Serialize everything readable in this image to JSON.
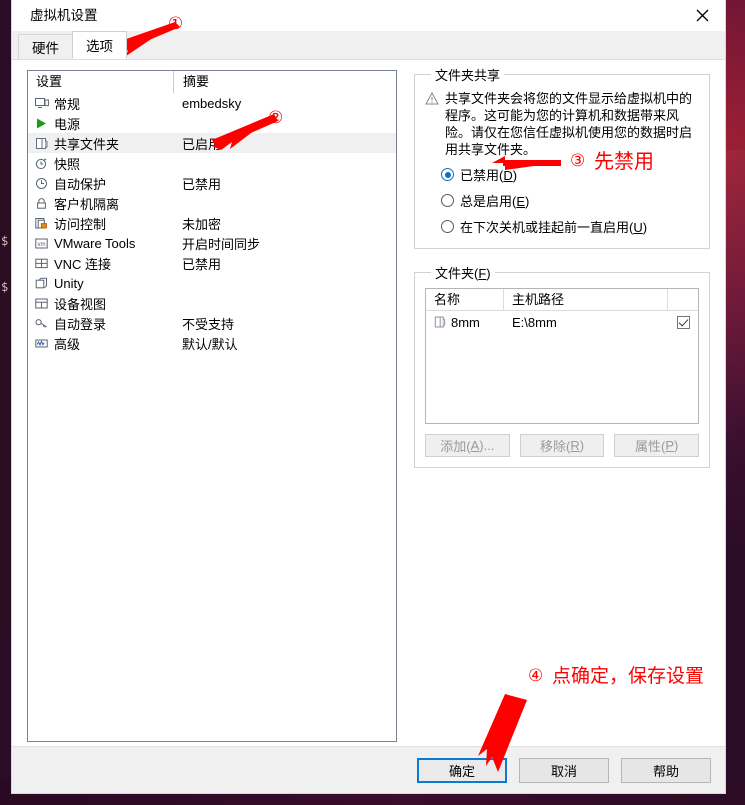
{
  "window": {
    "title": "虚拟机设置",
    "close_icon": "close-icon"
  },
  "tabs": [
    {
      "label": "硬件",
      "active": false
    },
    {
      "label": "选项",
      "active": true
    }
  ],
  "settings_list": {
    "headers": {
      "name": "设置",
      "summary": "摘要"
    },
    "rows": [
      {
        "icon": "monitor-icon",
        "label": "常规",
        "summary": "embedsky",
        "selected": false
      },
      {
        "icon": "power-play-icon",
        "label": "电源",
        "summary": "",
        "selected": false
      },
      {
        "icon": "shared-folder-icon",
        "label": "共享文件夹",
        "summary": "已启用",
        "selected": true
      },
      {
        "icon": "snapshot-clock-icon",
        "label": "快照",
        "summary": "",
        "selected": false
      },
      {
        "icon": "autoprotect-icon",
        "label": "自动保护",
        "summary": "已禁用",
        "selected": false
      },
      {
        "icon": "lock-icon",
        "label": "客户机隔离",
        "summary": "",
        "selected": false
      },
      {
        "icon": "access-control-icon",
        "label": "访问控制",
        "summary": "未加密",
        "selected": false
      },
      {
        "icon": "vmware-tools-icon",
        "label": "VMware Tools",
        "summary": "开启时间同步",
        "selected": false
      },
      {
        "icon": "vnc-icon",
        "label": "VNC 连接",
        "summary": "已禁用",
        "selected": false
      },
      {
        "icon": "unity-icon",
        "label": "Unity",
        "summary": "",
        "selected": false
      },
      {
        "icon": "device-view-icon",
        "label": "设备视图",
        "summary": "",
        "selected": false
      },
      {
        "icon": "autologin-key-icon",
        "label": "自动登录",
        "summary": "不受支持",
        "selected": false
      },
      {
        "icon": "advanced-icon",
        "label": "高级",
        "summary": "默认/默认",
        "selected": false
      }
    ]
  },
  "folder_sharing": {
    "legend": "文件夹共享",
    "warning_icon": "warning-triangle-icon",
    "warning_text": "共享文件夹会将您的文件显示给虚拟机中的程序。这可能为您的计算机和数据带来风险。请仅在您信任虚拟机使用您的数据时启用共享文件夹。",
    "options": [
      {
        "label": "已禁用(",
        "accel": "D",
        "tail": ")",
        "checked": true
      },
      {
        "label": "总是启用(",
        "accel": "E",
        "tail": ")",
        "checked": false
      },
      {
        "label": "在下次关机或挂起前一直启用(",
        "accel": "U",
        "tail": ")",
        "checked": false
      }
    ]
  },
  "folders": {
    "legend_pre": "文件夹(",
    "legend_accel": "F",
    "legend_post": ")",
    "columns": [
      "名称",
      "主机路径",
      ""
    ],
    "rows": [
      {
        "icon": "folder-icon",
        "name": "8mm",
        "path": "E:\\8mm",
        "enabled": true
      }
    ],
    "buttons": [
      {
        "pre": "添加(",
        "accel": "A",
        "post": ")...",
        "disabled": true
      },
      {
        "pre": "移除(",
        "accel": "R",
        "post": ")",
        "disabled": true
      },
      {
        "pre": "属性(",
        "accel": "P",
        "post": ")",
        "disabled": true
      }
    ]
  },
  "footer": {
    "ok": "确定",
    "cancel": "取消",
    "help": "帮助"
  },
  "annotations": {
    "color": "#ff0000",
    "items": [
      {
        "num": "①",
        "text": ""
      },
      {
        "num": "②",
        "text": ""
      },
      {
        "num": "③",
        "text": "先禁用"
      },
      {
        "num": "④",
        "text": "点确定，保存设置"
      }
    ]
  },
  "desktop": {
    "terminal_prompt_1": "$",
    "terminal_prompt_2": "$"
  }
}
